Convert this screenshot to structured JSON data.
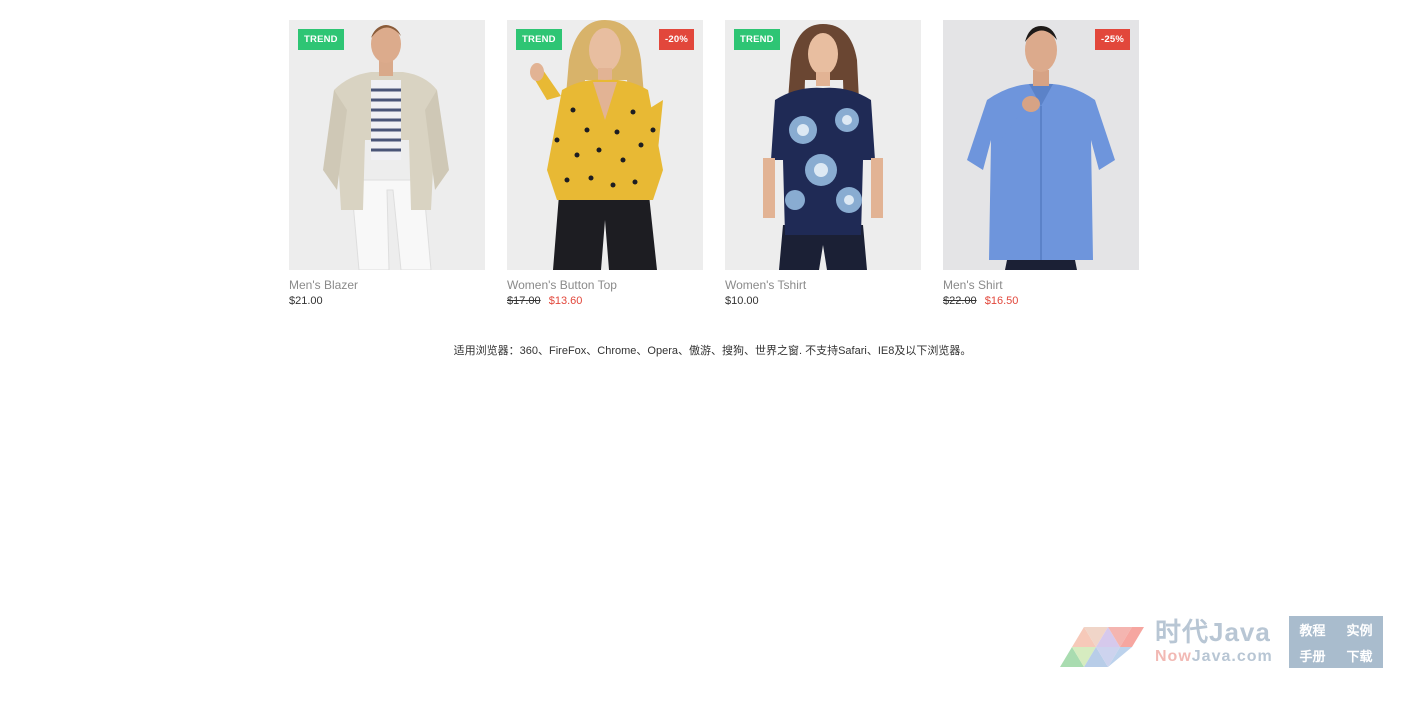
{
  "products": [
    {
      "name": "Men's Blazer",
      "price": "$21.00",
      "old_price": "",
      "new_price": "",
      "trend_badge": "TREND",
      "sale_badge": ""
    },
    {
      "name": "Women's Button Top",
      "price": "",
      "old_price": "$17.00",
      "new_price": "$13.60",
      "trend_badge": "TREND",
      "sale_badge": "-20%"
    },
    {
      "name": "Women's Tshirt",
      "price": "$10.00",
      "old_price": "",
      "new_price": "",
      "trend_badge": "TREND",
      "sale_badge": ""
    },
    {
      "name": "Men's Shirt",
      "price": "",
      "old_price": "$22.00",
      "new_price": "$16.50",
      "trend_badge": "",
      "sale_badge": "-25%"
    }
  ],
  "footer_note": "适用浏览器：360、FireFox、Chrome、Opera、傲游、搜狗、世界之窗. 不支持Safari、IE8及以下浏览器。",
  "watermark": {
    "title": "时代Java",
    "domain_prefix": "Now",
    "domain_rest": "Java.com",
    "links": [
      "教程",
      "实例",
      "手册",
      "下载"
    ]
  },
  "colors": {
    "trend_badge": "#2ec574",
    "sale_badge": "#e2473b",
    "sale_price": "#e2473b",
    "product_name": "#8a8a8a"
  },
  "icons": {
    "logo": "triangle-mosaic-logo"
  }
}
